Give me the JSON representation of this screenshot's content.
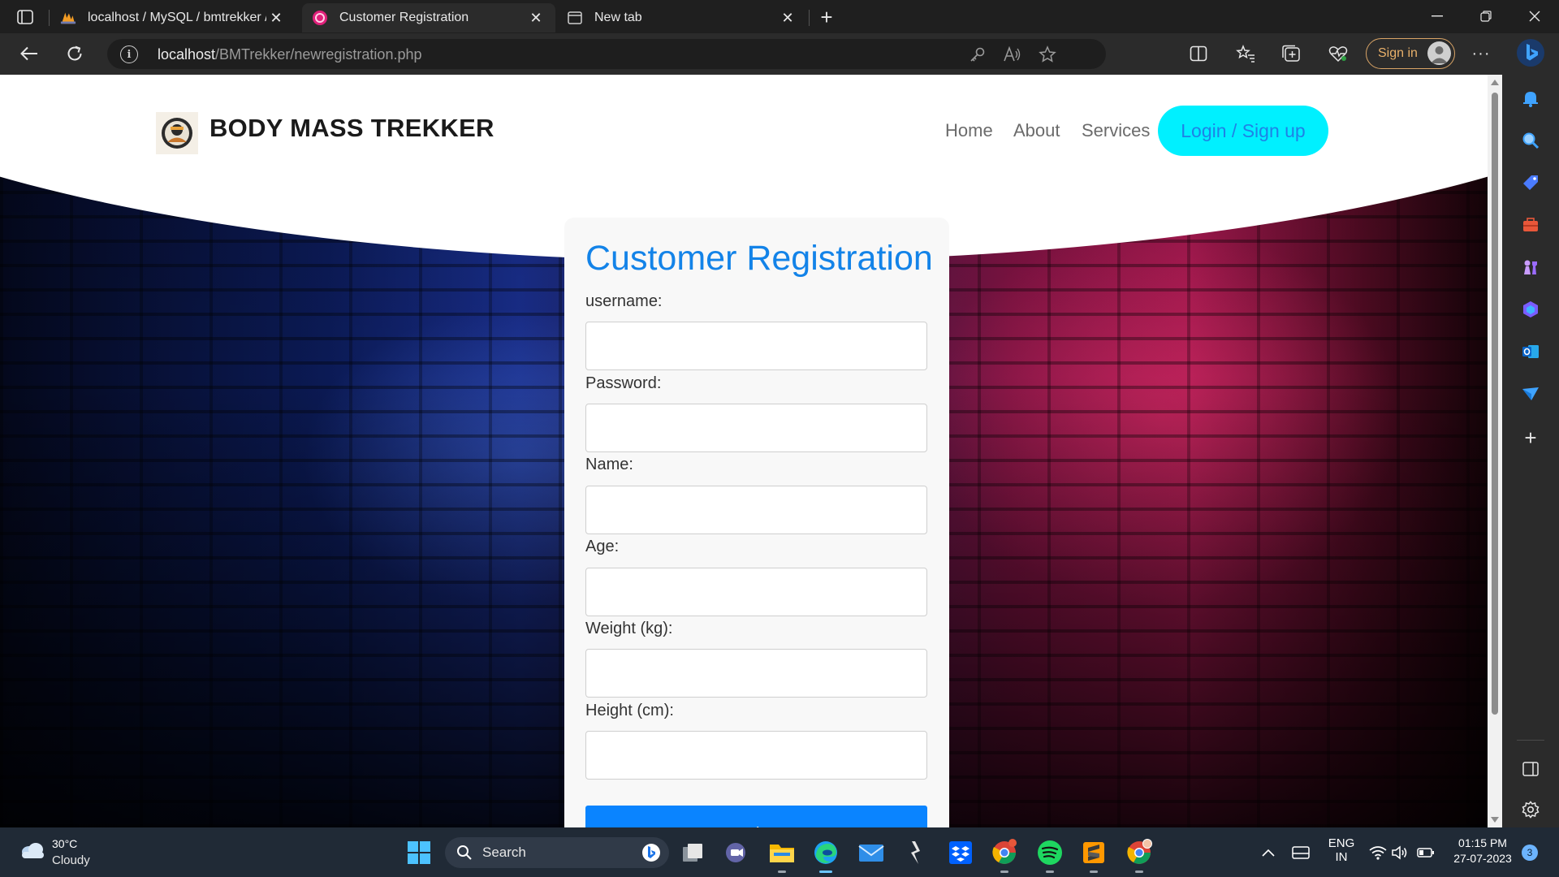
{
  "browser": {
    "tabs": [
      {
        "title": "localhost / MySQL / bmtrekker / ",
        "active": false
      },
      {
        "title": "Customer Registration",
        "active": true
      },
      {
        "title": "New tab",
        "active": false
      }
    ],
    "address": {
      "host": "localhost",
      "path": "/BMTrekker/newregistration.php"
    },
    "signin_label": "Sign in"
  },
  "site": {
    "brand": "BODY MASS TREKKER",
    "nav": {
      "home": "Home",
      "about": "About",
      "services": "Services",
      "login": "Login / Sign up"
    }
  },
  "form": {
    "title": "Customer Registration",
    "fields": [
      {
        "label": "username:",
        "value": ""
      },
      {
        "label": "Password:",
        "value": ""
      },
      {
        "label": "Name:",
        "value": ""
      },
      {
        "label": "Age:",
        "value": ""
      },
      {
        "label": "Weight (kg):",
        "value": ""
      },
      {
        "label": "Height (cm):",
        "value": ""
      }
    ],
    "submit_label": "Register"
  },
  "taskbar": {
    "weather": {
      "temp": "30°C",
      "desc": "Cloudy"
    },
    "search_label": "Search",
    "language": {
      "line1": "ENG",
      "line2": "IN"
    },
    "clock": {
      "time": "01:15 PM",
      "date": "27-07-2023"
    },
    "notification_count": "3"
  },
  "colors": {
    "accent": "#1383e8",
    "login_button": "#00f0ff",
    "register_button": "#0a84ff"
  }
}
